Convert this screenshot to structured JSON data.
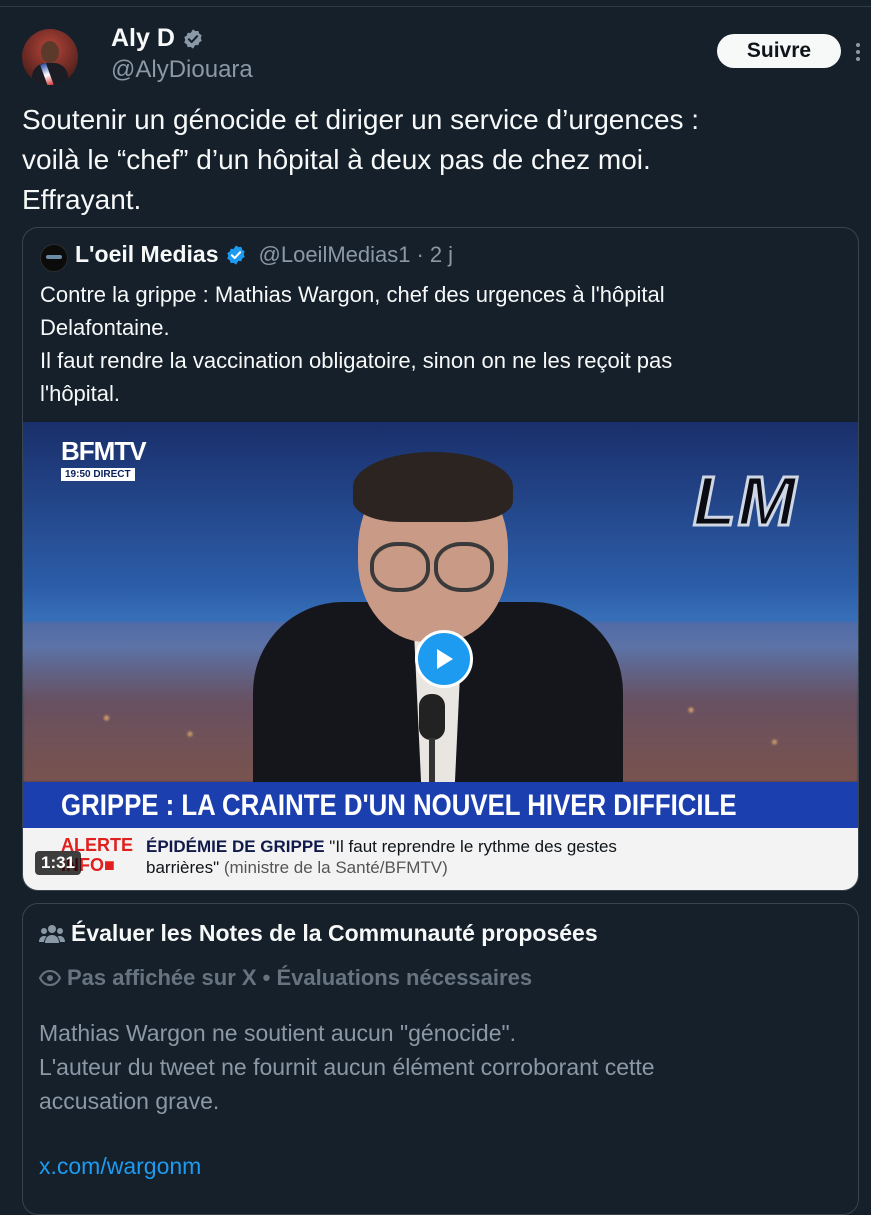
{
  "colors": {
    "background": "#15202b",
    "text_primary": "#f7f9f9",
    "text_secondary": "#8b98a5",
    "accent": "#1d9bf0",
    "border": "#38444d"
  },
  "author": {
    "name": "Aly D",
    "handle": "@AlyDiouara",
    "verified_icon": "verified-badge-gray",
    "follow_label": "Suivre"
  },
  "tweet": {
    "text_line1": "Soutenir un génocide et diriger un service d’urgences :",
    "text_line2": "voilà le “chef” d’un hôpital à deux pas de chez moi.",
    "text_line3": "Effrayant."
  },
  "quote": {
    "name": "L'oeil Medias",
    "handle": "@LoeilMedias1",
    "separator": "·",
    "time": "2 j",
    "verified_icon": "verified-badge-blue",
    "text_line1": "Contre la grippe : Mathias Wargon, chef des urgences à l'hôpital",
    "text_line2": "Delafontaine.",
    "text_line3": "Il faut rendre la vaccination obligatoire, sinon on ne les reçoit pas",
    "text_line4": "l'hôpital.",
    "video": {
      "channel_logo": "BFMTV",
      "live_time": "19:50 DIRECT",
      "watermark": "LM",
      "banner": "GRIPPE : LA CRAINTE D'UN NOUVEL HIVER DIFFICILE",
      "alert_label_line1": "ALERTE",
      "alert_label_line2": "INFO■",
      "ticker_strong": "ÉPIDÉMIE DE GRIPPE",
      "ticker_quote_part1": "\"Il faut reprendre le rythme des gestes",
      "ticker_quote_part2": "barrières\"",
      "ticker_source": "(ministre de la Santé/BFMTV)",
      "duration": "1:31",
      "play_icon": "play-icon"
    }
  },
  "community_note": {
    "title": "Évaluer les Notes de la Communauté proposées",
    "title_icon": "people-icon",
    "status": "Pas affichée sur X • Évaluations nécessaires",
    "status_icon": "eye-icon",
    "body_line1": "Mathias Wargon ne soutient aucun \"génocide\".",
    "body_line2": "L'auteur du tweet ne fournit aucun élément corroborant cette",
    "body_line3": "accusation grave.",
    "link": "x.com/wargonm"
  }
}
